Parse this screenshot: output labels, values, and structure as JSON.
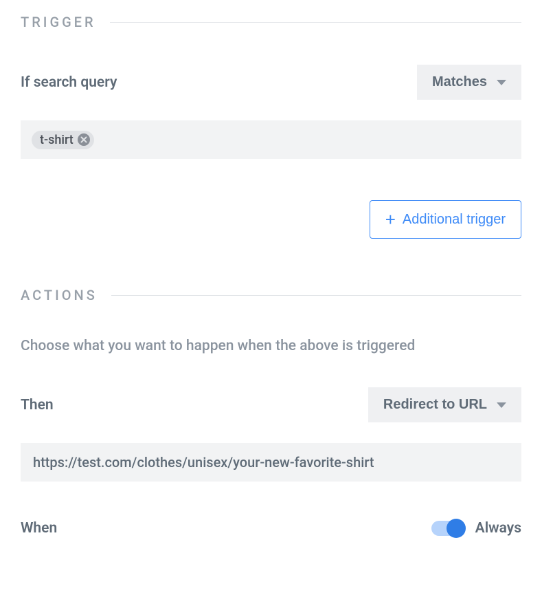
{
  "trigger": {
    "section_label": "TRIGGER",
    "condition_label": "If search query",
    "condition_dropdown": "Matches",
    "tags": [
      "t-shirt"
    ],
    "additional_trigger_label": "Additional trigger"
  },
  "actions": {
    "section_label": "ACTIONS",
    "description": "Choose what you want to happen when the above is triggered",
    "then_label": "Then",
    "then_dropdown": "Redirect to URL",
    "url_value": "https://test.com/clothes/unisex/your-new-favorite-shirt",
    "when_label": "When",
    "toggle_on": true,
    "toggle_label": "Always"
  }
}
